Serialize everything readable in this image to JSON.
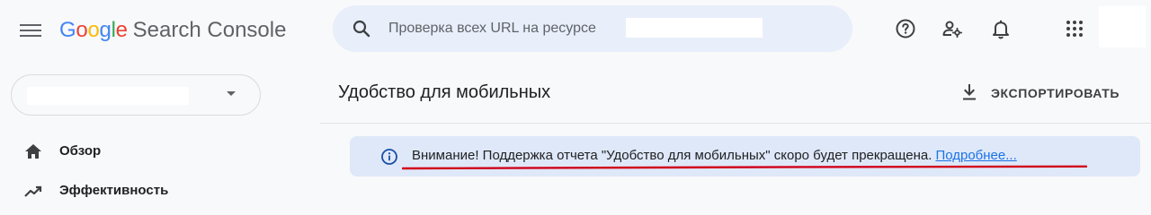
{
  "app": {
    "logo_letters": [
      "G",
      "o",
      "o",
      "g",
      "l",
      "e"
    ],
    "logo_colors": [
      "#4285f4",
      "#ea4335",
      "#fbbc05",
      "#4285f4",
      "#34a853",
      "#ea4335"
    ],
    "product_name": "Search Console"
  },
  "search": {
    "placeholder": "Проверка всех URL на ресурсе"
  },
  "header_icons": [
    "help-icon",
    "account-settings-icon",
    "notifications-icon",
    "apps-grid-icon",
    "avatar"
  ],
  "sidebar": {
    "items": [
      {
        "label": "Обзор",
        "icon": "home-icon"
      },
      {
        "label": "Эффективность",
        "icon": "trending-up-icon"
      }
    ]
  },
  "main": {
    "title": "Удобство для мобильных",
    "export_label": "ЭКСПОРТИРОВАТЬ"
  },
  "banner": {
    "text": "Внимание! Поддержка отчета \"Удобство для мобильных\" скоро будет прекращена.",
    "link": "Подробнее..."
  },
  "colors": {
    "accent": "#1a73e8",
    "banner_bg": "#dfe8f8",
    "highlight_mark": "#d0021b"
  }
}
